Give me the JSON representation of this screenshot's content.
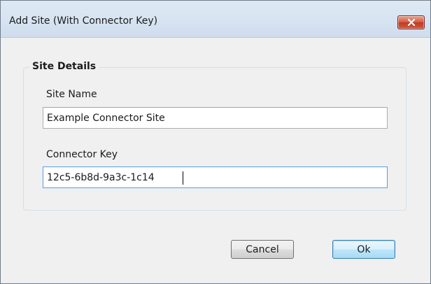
{
  "window": {
    "title": "Add Site (With Connector Key)",
    "close_icon": "close-icon"
  },
  "group": {
    "legend": "Site Details"
  },
  "fields": {
    "site_name": {
      "label": "Site Name",
      "value": "Example Connector Site"
    },
    "connector_key": {
      "label": "Connector Key",
      "value": "12c5-6b8d-9a3c-1c14"
    }
  },
  "buttons": {
    "cancel_label": "Cancel",
    "ok_label": "Ok"
  },
  "colors": {
    "close_button": "#c13a22",
    "focus_border": "#569de5",
    "default_button_border": "#3c7fb1"
  }
}
